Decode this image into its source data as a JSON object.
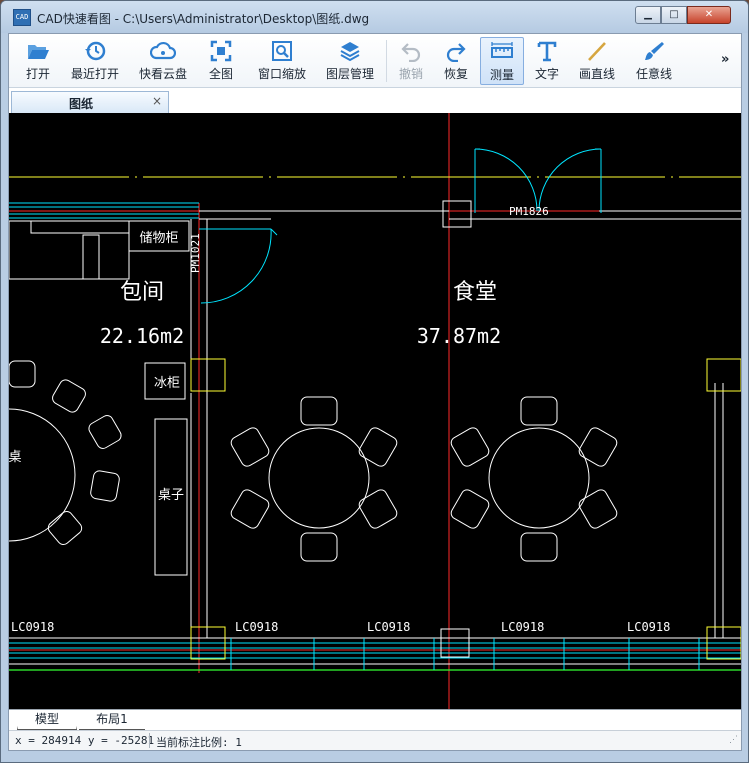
{
  "window": {
    "title": "CAD快速看图 - C:\\Users\\Administrator\\Desktop\\图纸.dwg",
    "app_icon_text": "CAD",
    "minimize_glyph": "▁",
    "maximize_glyph": "□",
    "close_glyph": "✕"
  },
  "toolbar": {
    "items": [
      {
        "label": "打开",
        "icon": "folder-open-icon"
      },
      {
        "label": "最近打开",
        "icon": "history-clock-icon"
      },
      {
        "label": "快看云盘",
        "icon": "cloud-icon"
      },
      {
        "label": "全图",
        "icon": "fit-all-icon"
      },
      {
        "label": "窗口缩放",
        "icon": "window-zoom-icon"
      },
      {
        "label": "图层管理",
        "icon": "layers-icon"
      },
      {
        "label": "撤销",
        "icon": "undo-icon",
        "disabled": true
      },
      {
        "label": "恢复",
        "icon": "redo-icon"
      },
      {
        "label": "测量",
        "icon": "ruler-icon",
        "active": true
      },
      {
        "label": "文字",
        "icon": "text-T-icon"
      },
      {
        "label": "画直线",
        "icon": "line-icon"
      },
      {
        "label": "任意线",
        "icon": "brush-icon"
      }
    ],
    "more_glyph": "»",
    "accent_color": "#2f7fd0"
  },
  "doc_tab": {
    "label": "图纸",
    "close_glyph": "×"
  },
  "drawing": {
    "background": "#000000",
    "room_labels": [
      {
        "name": "包间",
        "area": "22.16m2"
      },
      {
        "name": "食堂",
        "area": "37.87m2"
      }
    ],
    "furniture_labels": [
      "储物柜",
      "冰柜",
      "桌子",
      "桌"
    ],
    "door_tags": [
      "PM1021",
      "PM1826"
    ],
    "window_tags": [
      "LC0918",
      "LC0918",
      "LC0918",
      "LC0918",
      "LC0918"
    ],
    "colors": {
      "wall": "#ffffff",
      "axis": "#ff2a2a",
      "window": "#00e5ff",
      "door": "#00e5ff",
      "text": "#ffffff",
      "dim": "#ffff33",
      "ground": "#33ff33",
      "column": "#ffff33"
    }
  },
  "layout_tabs": [
    {
      "label": "模型",
      "active": true
    },
    {
      "label": "布局1",
      "active": false
    }
  ],
  "status": {
    "coords": "x = 284914 y = -25281",
    "scale": "当前标注比例: 1"
  }
}
